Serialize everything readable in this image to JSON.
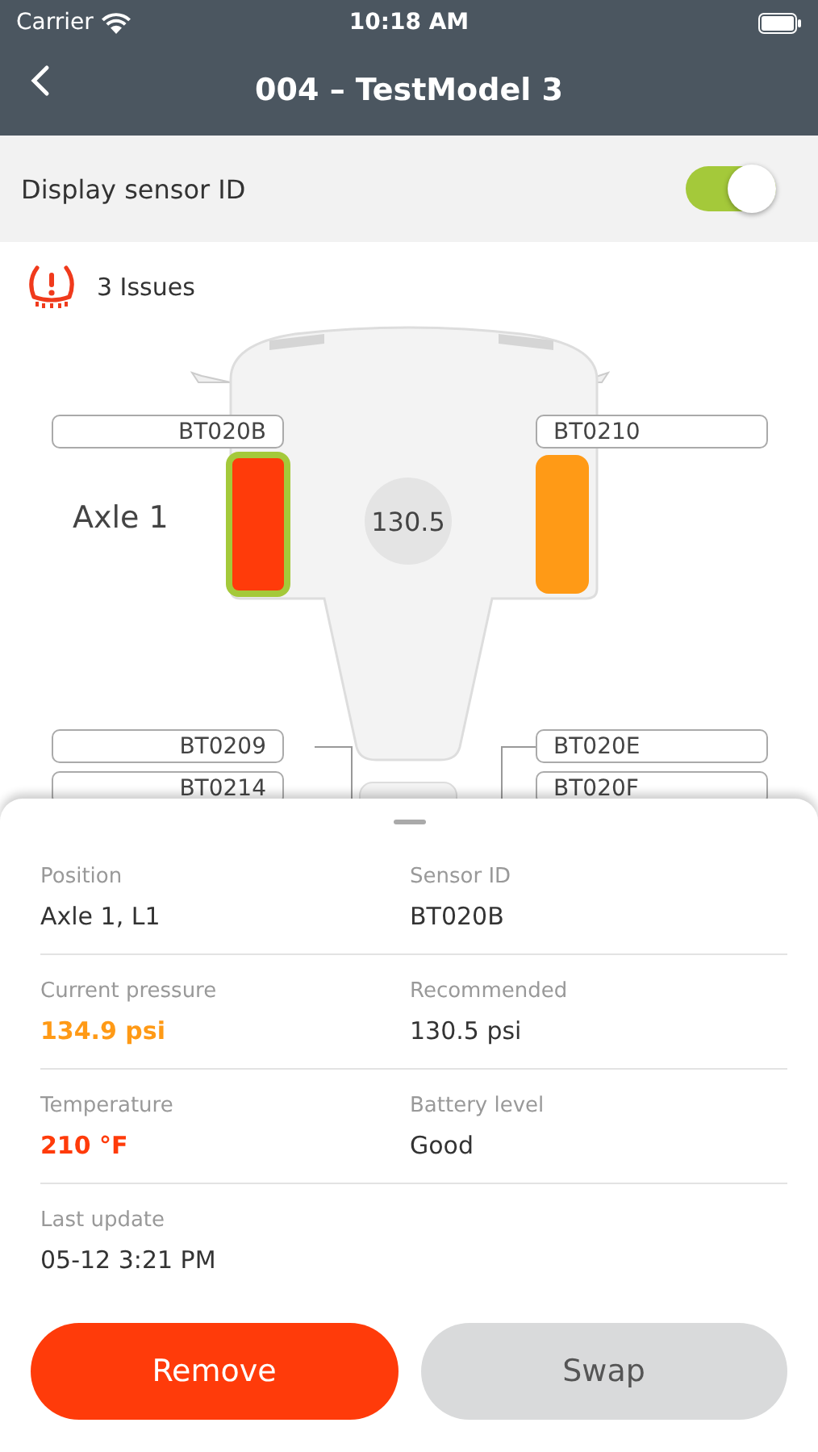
{
  "status_bar": {
    "carrier": "Carrier",
    "time": "10:18 AM"
  },
  "header": {
    "title": "004 – TestModel 3"
  },
  "toggle": {
    "label": "Display sensor ID",
    "on": true
  },
  "issues": {
    "text": "3 Issues"
  },
  "diagram": {
    "axle_label": "Axle 1",
    "center_value": "130.5",
    "tires": [
      {
        "sensor_id": "BT020B",
        "color": "#ff3b0a",
        "selected": true
      },
      {
        "sensor_id": "BT0210",
        "color": "#ff9a16",
        "selected": false
      }
    ],
    "rear_labels": [
      "BT0209",
      "BT0214",
      "BT020E",
      "BT020F"
    ]
  },
  "details": [
    {
      "label": "Position",
      "value": "Axle 1, L1",
      "kind": "plain"
    },
    {
      "label": "Sensor ID",
      "value": "BT020B",
      "kind": "plain"
    },
    {
      "label": "Current pressure",
      "value": "134.9 psi",
      "kind": "warning"
    },
    {
      "label": "Recommended",
      "value": "130.5 psi",
      "kind": "plain"
    },
    {
      "label": "Temperature",
      "value": "210 °F",
      "kind": "critical"
    },
    {
      "label": "Battery level",
      "value": "Good",
      "kind": "plain"
    },
    {
      "label": "Last update",
      "value": "05-12 3:21 PM",
      "kind": "plain"
    }
  ],
  "buttons": [
    {
      "label": "Remove",
      "kind": "primary"
    },
    {
      "label": "Swap",
      "kind": "secondary"
    }
  ]
}
